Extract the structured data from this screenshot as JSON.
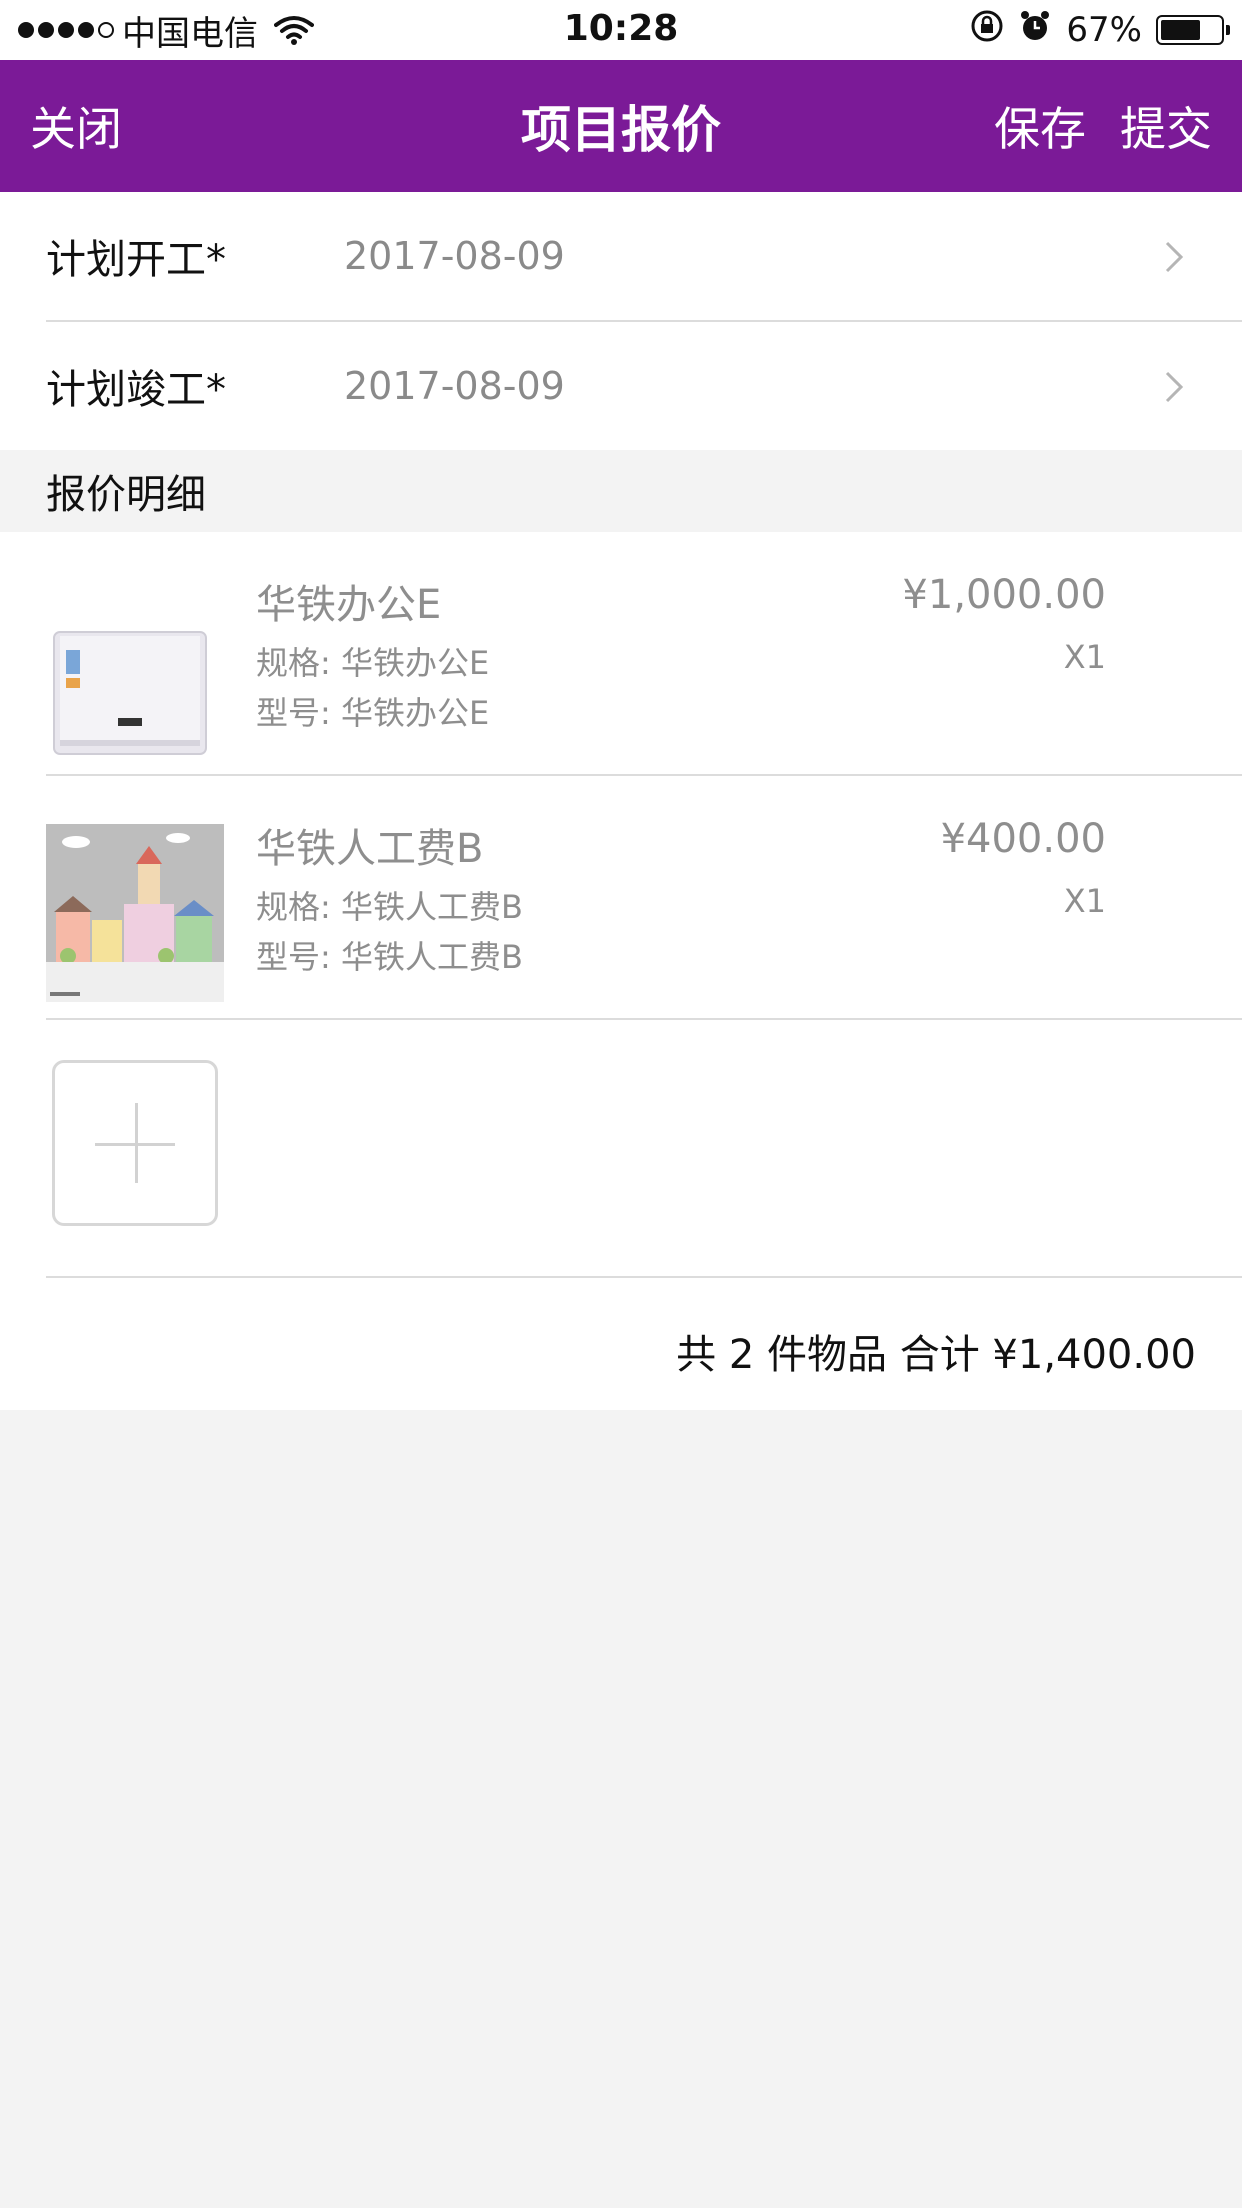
{
  "status_bar": {
    "carrier": "中国电信",
    "time": "10:28",
    "battery_percent_text": "67%",
    "battery_level": 0.67
  },
  "nav": {
    "close_label": "关闭",
    "title": "项目报价",
    "save_label": "保存",
    "submit_label": "提交",
    "accent_color": "#7b1a97"
  },
  "form": {
    "start": {
      "label": "计划开工*",
      "value": "2017-08-09"
    },
    "end": {
      "label": "计划竣工*",
      "value": "2017-08-09"
    }
  },
  "section": {
    "title": "报价明细"
  },
  "items": [
    {
      "name": "华铁办公E",
      "spec": "规格: 华铁办公E",
      "model": "型号: 华铁办公E",
      "price": "¥1,000.00",
      "qty": "X1",
      "thumbnail_icon": "air-conditioner-image"
    },
    {
      "name": "华铁人工费B",
      "spec": "规格: 华铁人工费B",
      "model": "型号: 华铁人工费B",
      "price": "¥400.00",
      "qty": "X1",
      "thumbnail_icon": "town-illustration-image"
    }
  ],
  "add_button_icon": "plus-icon",
  "summary": {
    "total_text": "共 2 件物品 合计 ¥1,400.00"
  }
}
